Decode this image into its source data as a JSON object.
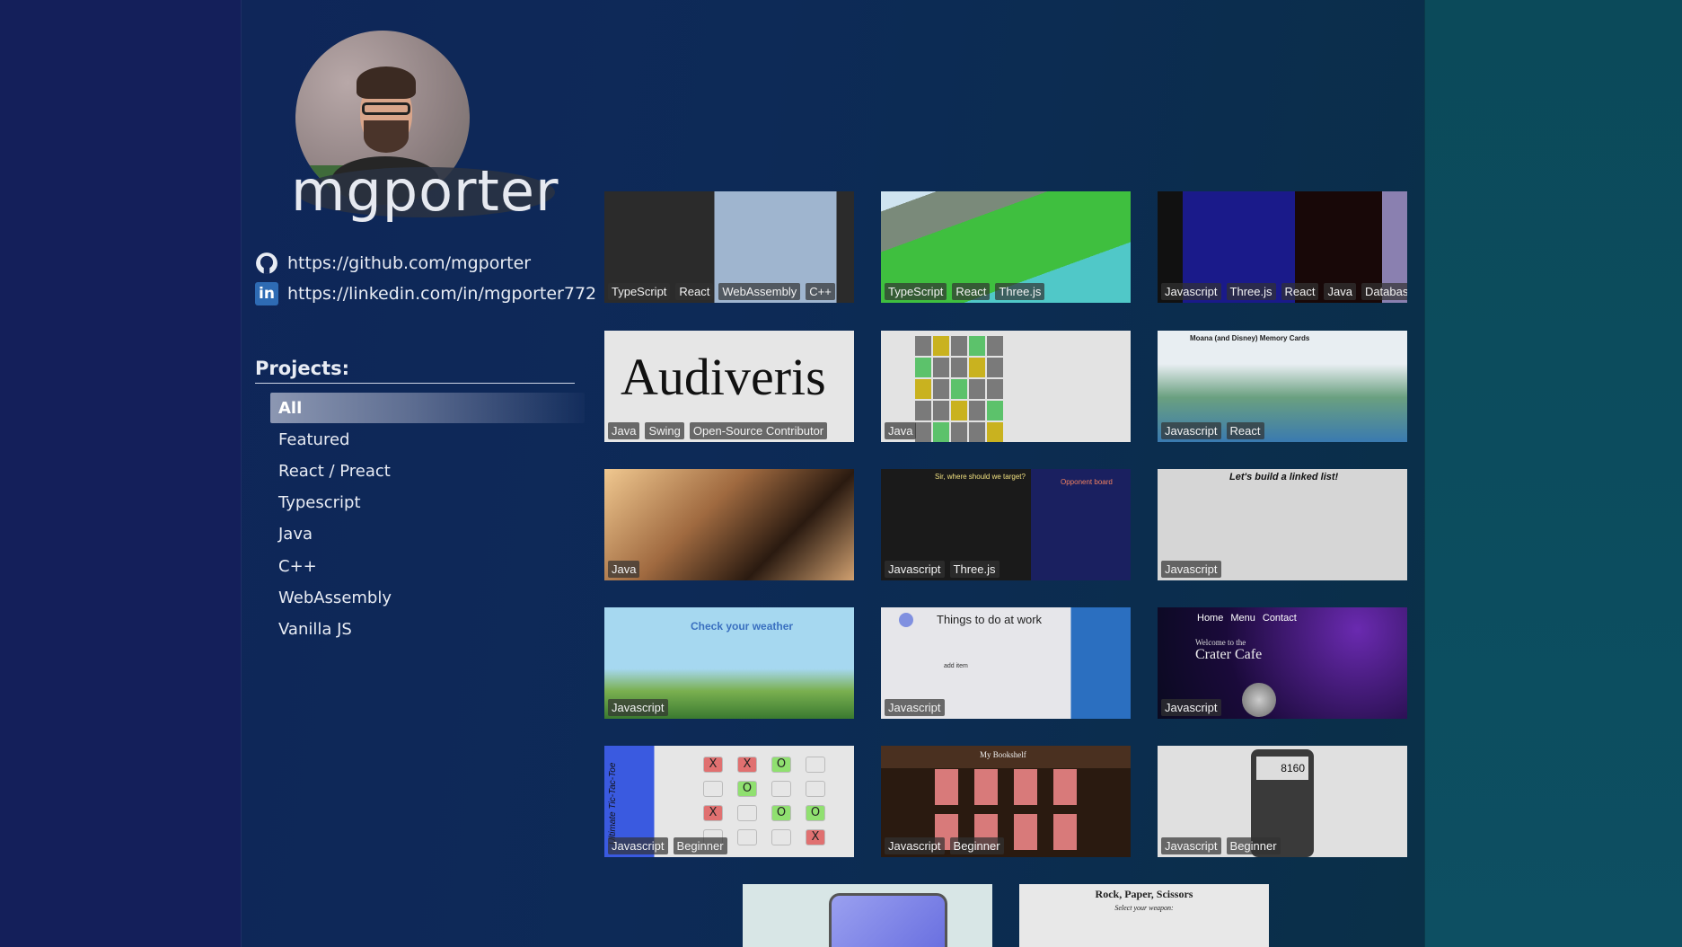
{
  "profile": {
    "name": "mgporter",
    "github_url": "https://github.com/mgporter",
    "linkedin_url": "https://linkedin.com/in/mgporter772",
    "linkedin_icon_text": "in"
  },
  "projects": {
    "heading": "Projects:",
    "categories": [
      "All",
      "Featured",
      "React / Preact",
      "Typescript",
      "Java",
      "C++",
      "WebAssembly",
      "Vanilla JS"
    ],
    "selected": "All"
  },
  "cards": [
    {
      "tags": [
        "TypeScript",
        "React",
        "WebAssembly",
        "C++"
      ]
    },
    {
      "tags": [
        "TypeScript",
        "React",
        "Three.js"
      ]
    },
    {
      "tags": [
        "Javascript",
        "Three.js",
        "React",
        "Java",
        "Database"
      ]
    },
    {
      "tags": [
        "Java",
        "Swing",
        "Open-Source Contributor"
      ],
      "text": "Audiveris"
    },
    {
      "tags": [
        "Java"
      ]
    },
    {
      "tags": [
        "Javascript",
        "React"
      ],
      "text": "Moana (and Disney) Memory Cards"
    },
    {
      "tags": [
        "Java"
      ]
    },
    {
      "tags": [
        "Javascript",
        "Three.js"
      ],
      "text": "Sir, where should we target?",
      "text2": "Opponent board"
    },
    {
      "tags": [
        "Javascript"
      ],
      "text": "Let's build a linked list!"
    },
    {
      "tags": [
        "Javascript"
      ],
      "text": "Check your weather"
    },
    {
      "tags": [
        "Javascript"
      ],
      "text": "Things to do at work",
      "text2": "add item"
    },
    {
      "tags": [
        "Javascript"
      ],
      "nav": [
        "Home",
        "Menu",
        "Contact"
      ],
      "text": "Welcome to the",
      "text2": "Crater Cafe"
    },
    {
      "tags": [
        "Javascript",
        "Beginner"
      ],
      "text": "Ultimate Tic-Tac-Toe"
    },
    {
      "tags": [
        "Javascript",
        "Beginner"
      ],
      "text": "My Bookshelf"
    },
    {
      "tags": [
        "Javascript",
        "Beginner"
      ],
      "text": "8160"
    },
    {
      "tags": []
    },
    {
      "tags": [],
      "text": "Rock, Paper, Scissors",
      "text2": "Select your weapon:"
    }
  ]
}
